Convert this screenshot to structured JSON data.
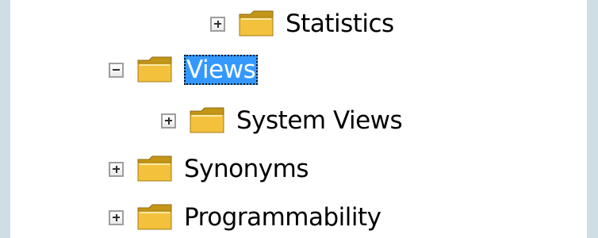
{
  "tree": {
    "items": [
      {
        "label": "Statistics",
        "state": "collapsed",
        "selected": false
      },
      {
        "label": "Views",
        "state": "expanded",
        "selected": true
      },
      {
        "label": "System Views",
        "state": "collapsed",
        "selected": false
      },
      {
        "label": "Synonyms",
        "state": "collapsed",
        "selected": false
      },
      {
        "label": "Programmability",
        "state": "collapsed",
        "selected": false
      }
    ]
  },
  "colors": {
    "background": "#cfdde4",
    "panel": "#ffffff",
    "selection": "#3399ff",
    "folder_front": "#f4c13d",
    "folder_back": "#c49618"
  }
}
